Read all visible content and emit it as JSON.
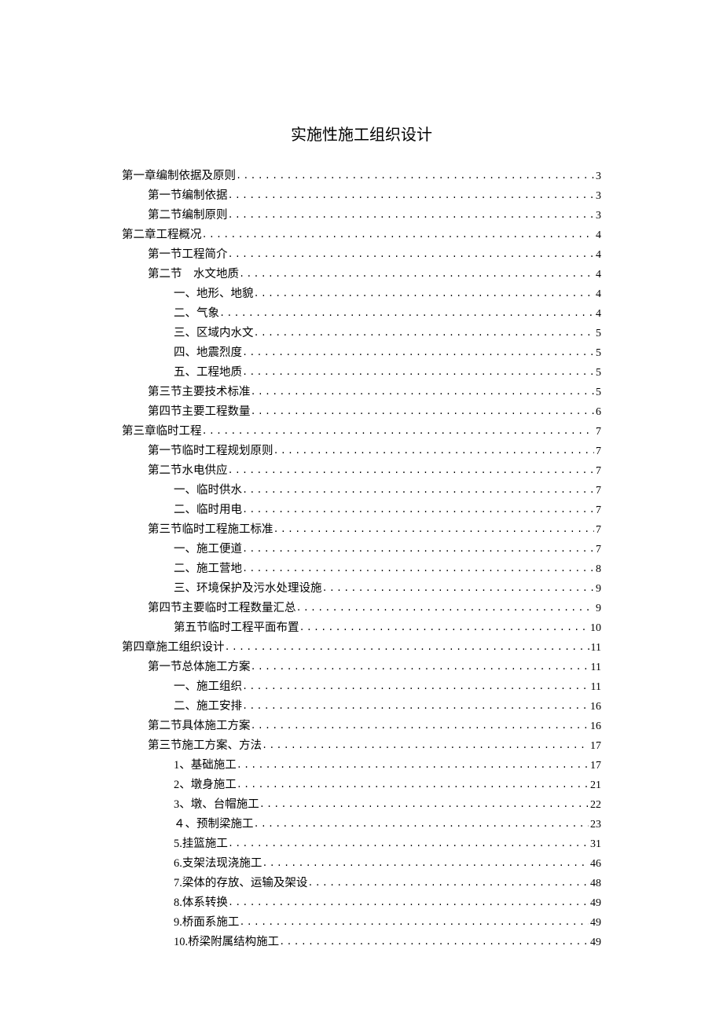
{
  "title": "实施性施工组织设计",
  "toc": [
    {
      "indent": 0,
      "label": "第一章编制依据及原则",
      "page": "3"
    },
    {
      "indent": 1,
      "label": "第一节编制依据",
      "page": "3"
    },
    {
      "indent": 1,
      "label": "第二节编制原则",
      "page": "3"
    },
    {
      "indent": 0,
      "label": "第二章工程概况",
      "page": "4"
    },
    {
      "indent": 1,
      "label": "第一节工程简介",
      "page": "4"
    },
    {
      "indent": 1,
      "label": "第二节　水文地质",
      "page": "4"
    },
    {
      "indent": 2,
      "label": "一、地形、地貌",
      "page": "4"
    },
    {
      "indent": 2,
      "label": "二、气象",
      "page": "4"
    },
    {
      "indent": 2,
      "label": "三、区域内水文",
      "page": "5"
    },
    {
      "indent": 2,
      "label": "四、地震烈度",
      "page": "5"
    },
    {
      "indent": 2,
      "label": "五、工程地质",
      "page": "5"
    },
    {
      "indent": 1,
      "label": "第三节主要技术标准",
      "page": "5"
    },
    {
      "indent": 1,
      "label": "第四节主要工程数量",
      "page": "6"
    },
    {
      "indent": 0,
      "label": "第三章临时工程",
      "page": "7"
    },
    {
      "indent": 1,
      "label": "第一节临时工程规划原则",
      "page": "7"
    },
    {
      "indent": 1,
      "label": "第二节水电供应",
      "page": "7"
    },
    {
      "indent": 2,
      "label": "一、临时供水",
      "page": "7"
    },
    {
      "indent": 2,
      "label": "二、临时用电",
      "page": "7"
    },
    {
      "indent": 1,
      "label": "第三节临时工程施工标准",
      "page": "7"
    },
    {
      "indent": 2,
      "label": "一、施工便道",
      "page": "7"
    },
    {
      "indent": 2,
      "label": "二、施工营地",
      "page": "8"
    },
    {
      "indent": 2,
      "label": "三、环境保护及污水处理设施",
      "page": "9"
    },
    {
      "indent": 1,
      "label": "第四节主要临时工程数量汇总",
      "page": "9"
    },
    {
      "indent": 2,
      "label": "第五节临时工程平面布置",
      "page": "10"
    },
    {
      "indent": 0,
      "label": "第四章施工组织设计",
      "page": "11"
    },
    {
      "indent": 1,
      "label": "第一节总体施工方案",
      "page": "11"
    },
    {
      "indent": 2,
      "label": "一、施工组织",
      "page": "11"
    },
    {
      "indent": 2,
      "label": "二、施工安排",
      "page": "16"
    },
    {
      "indent": 1,
      "label": "第二节具体施工方案",
      "page": "16"
    },
    {
      "indent": 1,
      "label": "第三节施工方案、方法",
      "page": "17"
    },
    {
      "indent": 2,
      "label": "1、基础施工",
      "page": "17"
    },
    {
      "indent": 2,
      "label": "2、墩身施工",
      "page": "21"
    },
    {
      "indent": 2,
      "label": "3、墩、台帽施工",
      "page": "22"
    },
    {
      "indent": 2,
      "label": "４、预制梁施工",
      "page": "23"
    },
    {
      "indent": 2,
      "label": "5.挂篮施工",
      "page": "31"
    },
    {
      "indent": 2,
      "label": "6.支架法现浇施工",
      "page": "46"
    },
    {
      "indent": 2,
      "label": "7.梁体的存放、运输及架设",
      "page": "48"
    },
    {
      "indent": 2,
      "label": "8.体系转换",
      "page": "49"
    },
    {
      "indent": 2,
      "label": "9.桥面系施工",
      "page": "49"
    },
    {
      "indent": 2,
      "label": "10.桥梁附属结构施工",
      "page": "49"
    }
  ]
}
